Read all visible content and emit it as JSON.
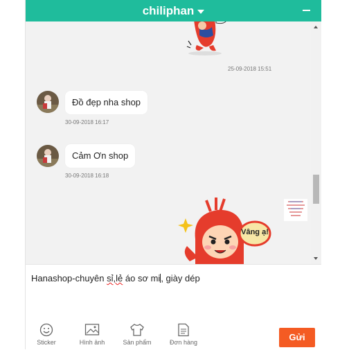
{
  "header": {
    "title": "chiliphan"
  },
  "messages": [
    {
      "timestamp": "25-09-2018 15:51",
      "side": "right",
      "kind": "sticker"
    },
    {
      "side": "left",
      "text": "Đồ đẹp nha shop",
      "timestamp": "30-09-2018 16:17"
    },
    {
      "side": "left",
      "text": "Cảm Ơn shop",
      "timestamp": "30-09-2018 16:18"
    },
    {
      "side": "right",
      "kind": "sticker",
      "sticker_text": "Vâng ạ!"
    }
  ],
  "composer": {
    "text_a": "Hanashop-chuyên ",
    "text_b": "sỉ,lẻ",
    "text_c": " áo sơ mi",
    "text_d": ", giày dép"
  },
  "toolbar": {
    "sticker": "Sticker",
    "image": "Hình ảnh",
    "product": "Sản phẩm",
    "order": "Đơn hàng",
    "send": "Gửi"
  },
  "colors": {
    "accent": "#1fbc9c",
    "send": "#f45b23"
  }
}
